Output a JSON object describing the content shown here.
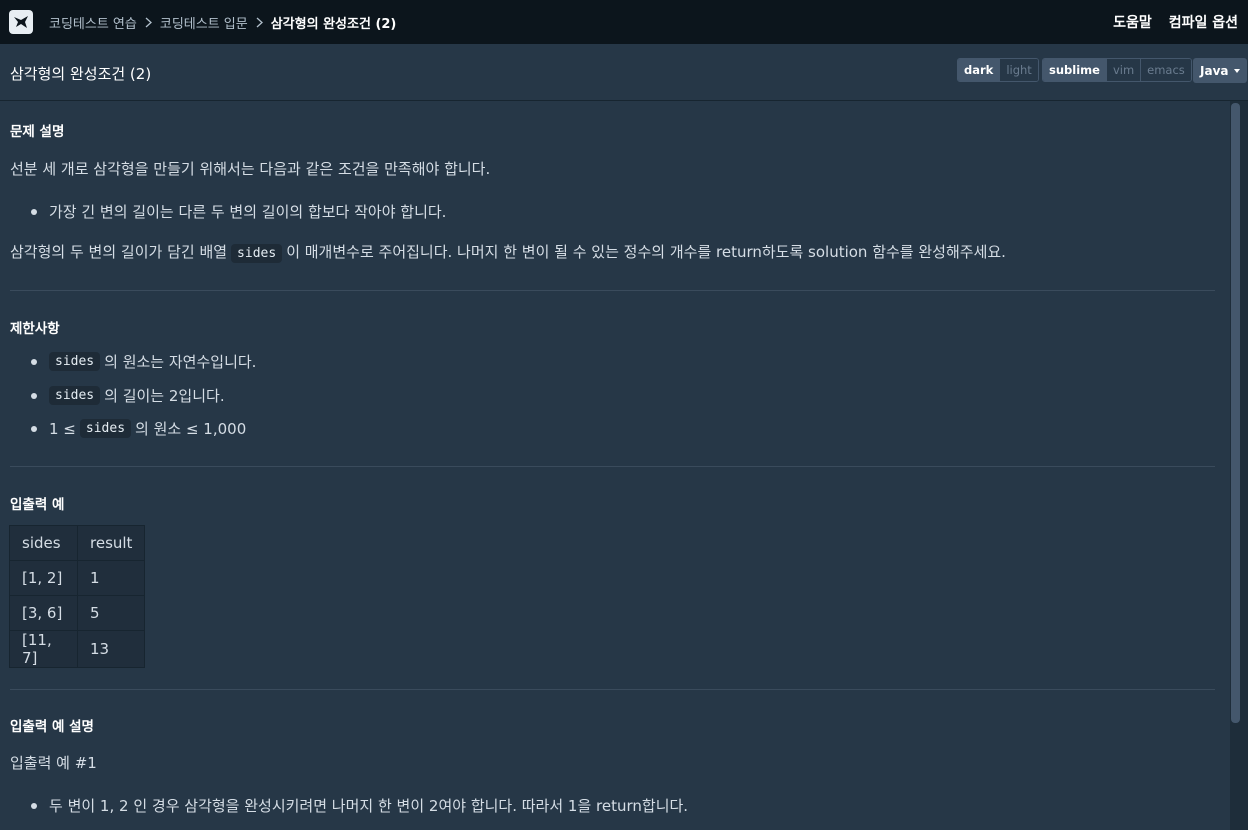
{
  "nav": {
    "breadcrumbs": [
      "코딩테스트 연습",
      "코딩테스트 입문"
    ],
    "current": "삼각형의 완성조건 (2)",
    "help": "도움말",
    "compile_options": "컴파일 옵션"
  },
  "toolbar": {
    "title": "삼각형의 완성조건 (2)",
    "themes": [
      "dark",
      "light"
    ],
    "active_theme": "dark",
    "keymaps": [
      "sublime",
      "vim",
      "emacs"
    ],
    "active_keymap": "sublime",
    "language": "Java"
  },
  "problem": {
    "description_heading": "문제 설명",
    "intro": "선분 세 개로 삼각형을 만들기 위해서는 다음과 같은 조건을 만족해야 합니다.",
    "condition": "가장 긴 변의 길이는 다른 두 변의 길이의 합보다 작아야 합니다.",
    "task_before": "삼각형의 두 변의 길이가 담긴 배열",
    "task_code": "sides",
    "task_after": "이 매개변수로 주어집니다. 나머지 한 변이 될 수 있는 정수의 개수를 return하도록 solution 함수를 완성해주세요.",
    "constraints_heading": "제한사항",
    "constraints": [
      {
        "prefix": "",
        "code": "sides",
        "suffix": "의 원소는 자연수입니다."
      },
      {
        "prefix": "",
        "code": "sides",
        "suffix": "의 길이는 2입니다."
      },
      {
        "prefix": "1 ≤",
        "code": "sides",
        "suffix": "의 원소 ≤ 1,000"
      }
    ],
    "examples_heading": "입출력 예",
    "table": {
      "headers": [
        "sides",
        "result"
      ],
      "rows": [
        [
          "[1, 2]",
          "1"
        ],
        [
          "[3, 6]",
          "5"
        ],
        [
          "[11, 7]",
          "13"
        ]
      ]
    },
    "explanation_heading": "입출력 예 설명",
    "example1_title": "입출력 예 #1",
    "example1_item": "두 변이 1, 2 인 경우 삼각형을 완성시키려면 나머지 한 변이 2여야 합니다. 따라서 1을 return합니다."
  },
  "colors": {
    "background": "#263747",
    "navbar": "#0c151c",
    "accent": "#44576c"
  }
}
